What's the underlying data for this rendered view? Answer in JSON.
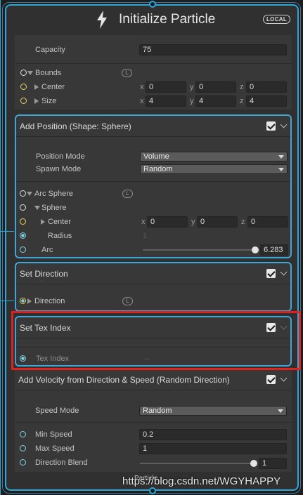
{
  "header": {
    "title": "Initialize Particle",
    "badge": "LOCAL"
  },
  "capacity": {
    "label": "Capacity",
    "value": "75"
  },
  "bounds": {
    "label": "Bounds",
    "badge": "L",
    "center": {
      "label": "Center",
      "x": "0",
      "y": "0",
      "z": "0"
    },
    "size": {
      "label": "Size",
      "x": "4",
      "y": "4",
      "z": "4"
    }
  },
  "add_position": {
    "title": "Add Position (Shape: Sphere)",
    "position_mode": {
      "label": "Position Mode",
      "value": "Volume"
    },
    "spawn_mode": {
      "label": "Spawn Mode",
      "value": "Random"
    },
    "arc_sphere": {
      "label": "Arc Sphere",
      "badge": "L"
    },
    "sphere": {
      "label": "Sphere"
    },
    "center": {
      "label": "Center",
      "x": "0",
      "y": "0",
      "z": "0"
    },
    "radius": {
      "label": "Radius",
      "value": "1"
    },
    "arc": {
      "label": "Arc",
      "value": "6.283",
      "fraction": 1.0
    }
  },
  "set_direction": {
    "title": "Set Direction",
    "direction": {
      "label": "Direction",
      "badge": "L"
    }
  },
  "set_tex_index": {
    "title": "Set Tex Index",
    "tex_index": {
      "label": "Tex Index",
      "value": "—"
    }
  },
  "add_velocity": {
    "title": "Add Velocity from Direction & Speed (Random Direction)",
    "speed_mode": {
      "label": "Speed Mode",
      "value": "Random"
    },
    "min_speed": {
      "label": "Min Speed",
      "value": "0.2"
    },
    "max_speed": {
      "label": "Max Speed",
      "value": "1"
    },
    "direction_blend": {
      "label": "Direction Blend",
      "value": "1",
      "fraction": 1.0
    }
  },
  "axes": {
    "x": "x",
    "y": "y",
    "z": "z"
  },
  "footer": {
    "particle_label": "Particle",
    "watermark": "https://blog.csdn.net/WGYHAPPY"
  },
  "colors": {
    "accent": "#2fa7d9",
    "highlight_box": "#e0221e"
  }
}
